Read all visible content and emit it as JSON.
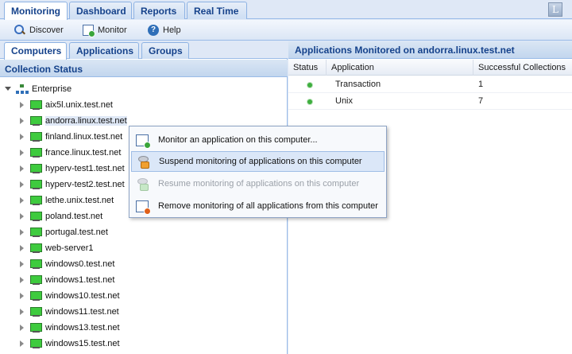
{
  "top_tabs": [
    {
      "label": "Monitoring",
      "active": true
    },
    {
      "label": "Dashboard",
      "active": false
    },
    {
      "label": "Reports",
      "active": false
    },
    {
      "label": "Real Time",
      "active": false
    }
  ],
  "logo_letter": "L",
  "toolbar": {
    "discover_label": "Discover",
    "monitor_label": "Monitor",
    "help_label": "Help"
  },
  "left": {
    "tabs": [
      {
        "label": "Computers",
        "active": true
      },
      {
        "label": "Applications",
        "active": false
      },
      {
        "label": "Groups",
        "active": false
      }
    ],
    "header": "Collection Status",
    "tree_root": "Enterprise",
    "computers": [
      "aix5l.unix.test.net",
      "andorra.linux.test.net",
      "finland.linux.test.net",
      "france.linux.test.net",
      "hyperv-test1.test.net",
      "hyperv-test2.test.net",
      "lethe.unix.test.net",
      "poland.test.net",
      "portugal.test.net",
      "web-server1",
      "windows0.test.net",
      "windows1.test.net",
      "windows10.test.net",
      "windows11.test.net",
      "windows13.test.net",
      "windows15.test.net"
    ],
    "selected_computer": "andorra.linux.test.net"
  },
  "right": {
    "header": "Applications Monitored on andorra.linux.test.net",
    "columns": [
      "Status",
      "Application",
      "Successful Collections"
    ],
    "rows": [
      {
        "status": "ok",
        "application": "Transaction",
        "successful": "1"
      },
      {
        "status": "ok",
        "application": "Unix",
        "successful": "7"
      }
    ]
  },
  "context_menu": {
    "items": [
      {
        "label": "Monitor an application on this computer...",
        "icon": "monitor-add-icon",
        "disabled": false,
        "highlighted": false
      },
      {
        "label": "Suspend monitoring of applications on this computer",
        "icon": "suspend-icon",
        "disabled": false,
        "highlighted": true
      },
      {
        "label": "Resume monitoring of applications on this computer",
        "icon": "resume-icon",
        "disabled": true,
        "highlighted": false
      },
      {
        "label": "Remove monitoring of all applications from this computer",
        "icon": "remove-icon",
        "disabled": false,
        "highlighted": false
      }
    ]
  },
  "colors": {
    "accent": "#15428b",
    "status_ok": "#3fae3f",
    "panel_bg": "#dfe8f6"
  }
}
